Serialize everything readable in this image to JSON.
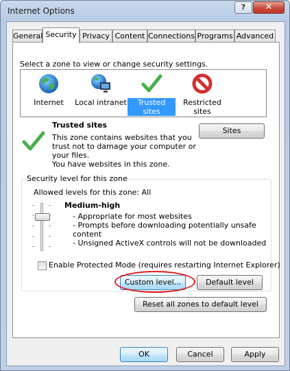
{
  "window": {
    "title": "Internet Options",
    "help_label": "?",
    "close_label": "✕"
  },
  "tabs": [
    {
      "label": "General"
    },
    {
      "label": "Security",
      "active": true
    },
    {
      "label": "Privacy"
    },
    {
      "label": "Content"
    },
    {
      "label": "Connections"
    },
    {
      "label": "Programs"
    },
    {
      "label": "Advanced"
    }
  ],
  "security": {
    "instruction": "Select a zone to view or change security settings.",
    "zones": [
      {
        "label": "Internet",
        "icon": "globe-icon"
      },
      {
        "label": "Local intranet",
        "icon": "intranet-icon"
      },
      {
        "label": "Trusted sites",
        "icon": "checkmark-icon",
        "selected": true
      },
      {
        "label": "Restricted sites",
        "label_line1": "Restricted",
        "label_line2": "sites",
        "icon": "no-entry-icon"
      }
    ],
    "zone_info": {
      "title": "Trusted sites",
      "desc_line1": "This zone contains websites that you",
      "desc_line2": "trust not to damage your computer or",
      "desc_line3": "your files.",
      "desc_line4": "You have websites in this zone.",
      "sites_button": "Sites"
    },
    "level": {
      "group_title": "Security level for this zone",
      "allowed": "Allowed levels for this zone: All",
      "level_name": "Medium-high",
      "bullet1": "- Appropriate for most websites",
      "bullet2": "- Prompts before downloading potentially unsafe",
      "bullet2_cont": "content",
      "bullet3": "- Unsigned ActiveX controls will not be downloaded"
    },
    "protected_mode_label": "Enable Protected Mode (requires restarting Internet Explorer)",
    "protected_mode_checked": false,
    "custom_level_button": "Custom level...",
    "default_level_button": "Default level",
    "reset_button": "Reset all zones to default level"
  },
  "footer": {
    "ok": "OK",
    "cancel": "Cancel",
    "apply": "Apply"
  },
  "colors": {
    "selection": "#3399ff",
    "annotation": "#e01b1b",
    "check_green": "#3fae3a"
  }
}
